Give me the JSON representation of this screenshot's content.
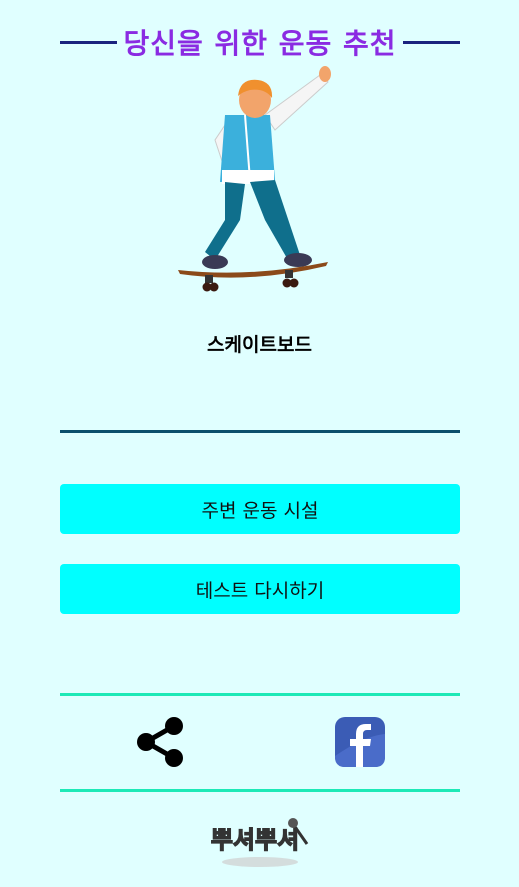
{
  "header": {
    "title": "당신을 위한 운동 추천"
  },
  "result": {
    "exercise_name": "스케이트보드",
    "image_icon": "skateboarder-illustration"
  },
  "buttons": {
    "nearby_facilities": "주변 운동 시설",
    "retake_test": "테스트 다시하기"
  },
  "share": {
    "share_icon": "share-icon",
    "facebook_icon": "facebook-icon"
  },
  "footer": {
    "logo_icon": "logo-icon",
    "logo_text": "뿌셔뿌셔"
  },
  "colors": {
    "background": "#e0ffff",
    "title": "#8a2be2",
    "button": "#00ffff",
    "accent_line": "#1de9b6",
    "dark_line": "#0b4f6c"
  }
}
